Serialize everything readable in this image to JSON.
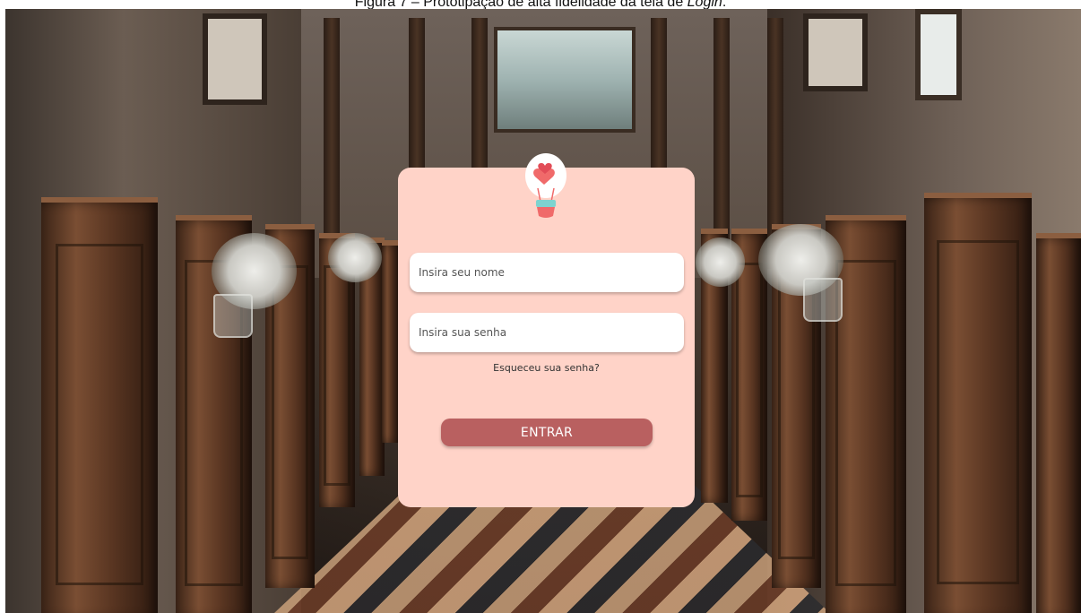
{
  "caption": {
    "prefix": "Figura 7 – Prototipação de alta fidelidade da tela de ",
    "italic": "Login",
    "suffix": "."
  },
  "login": {
    "name_placeholder": "Insira seu nome",
    "password_placeholder": "Insira sua senha",
    "forgot_label": "Esqueceu sua senha?",
    "enter_label": "ENTRAR"
  },
  "colors": {
    "card_background": "#ffd3c8",
    "button_background": "#b96060",
    "button_text": "#ffffff",
    "balloon_heart": "#f06a6a",
    "basket": "#7ed3cf"
  },
  "icons": {
    "logo": "heart-balloon-icon"
  }
}
